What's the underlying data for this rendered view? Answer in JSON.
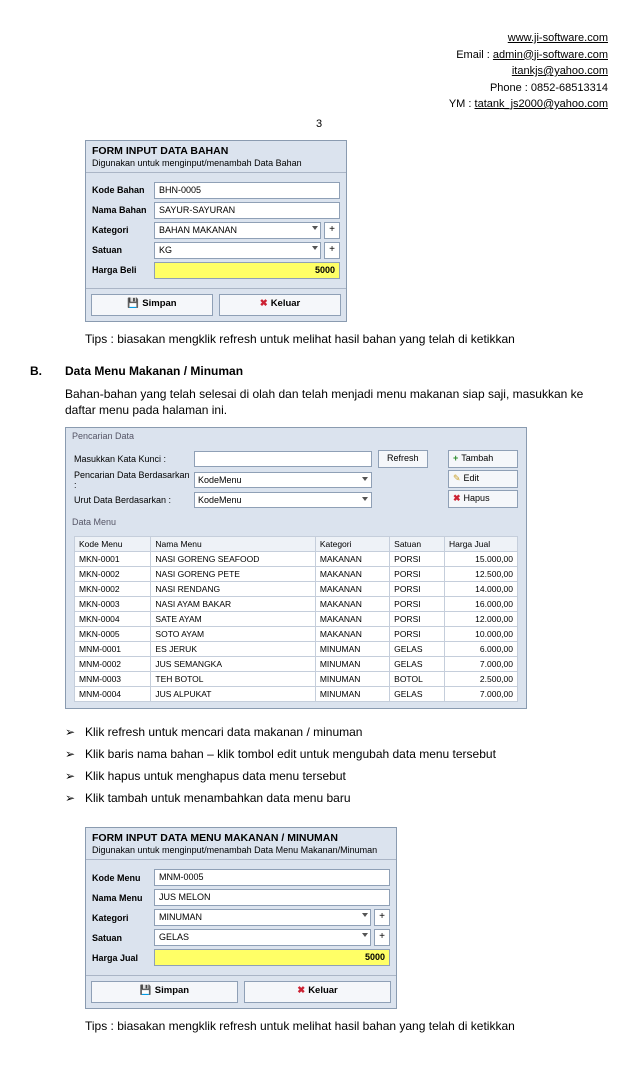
{
  "header": {
    "site": "www.ji-software.com",
    "email_label": "Email : ",
    "email": "admin@ji-software.com",
    "email2": "itankjs@yahoo.com",
    "phone": "Phone : 0852-68513314",
    "ym_label": "YM : ",
    "ym": "tatank_js2000@yahoo.com"
  },
  "page_number": "3",
  "form1": {
    "title": "FORM INPUT DATA BAHAN",
    "subtitle": "Digunakan untuk menginput/menambah Data Bahan",
    "fields": {
      "kode_label": "Kode Bahan",
      "kode_val": "BHN-0005",
      "nama_label": "Nama Bahan",
      "nama_val": "SAYUR-SAYURAN",
      "kat_label": "Kategori",
      "kat_val": "BAHAN MAKANAN",
      "sat_label": "Satuan",
      "sat_val": "KG",
      "harga_label": "Harga Beli",
      "harga_val": "5000"
    },
    "simpan": "Simpan",
    "keluar": "Keluar"
  },
  "tips1": "Tips : biasakan mengklik refresh untuk melihat hasil bahan yang telah di ketikkan",
  "sectionB": {
    "letter": "B.",
    "title": "Data Menu Makanan / Minuman",
    "intro": "Bahan-bahan yang telah selesai di olah dan telah menjadi menu makanan siap saji, masukkan ke daftar menu pada halaman ini."
  },
  "search": {
    "sec1": "Pencarian Data",
    "kata_label": "Masukkan Kata Kunci :",
    "refresh": "Refresh",
    "berdasar_label": "Pencarian Data Berdasarkan :",
    "berdasar_val": "KodeMenu",
    "urut_label": "Urut Data Berdasarkan :",
    "urut_val": "KodeMenu",
    "tambah": "Tambah",
    "edit": "Edit",
    "hapus": "Hapus",
    "sec2": "Data Menu"
  },
  "table": {
    "headers": [
      "Kode Menu",
      "Nama Menu",
      "Kategori",
      "Satuan",
      "Harga Jual"
    ],
    "rows": [
      [
        "MKN-0001",
        "NASI GORENG SEAFOOD",
        "MAKANAN",
        "PORSI",
        "15.000,00"
      ],
      [
        "MKN-0002",
        "NASI GORENG PETE",
        "MAKANAN",
        "PORSI",
        "12.500,00"
      ],
      [
        "MKN-0002",
        "NASI RENDANG",
        "MAKANAN",
        "PORSI",
        "14.000,00"
      ],
      [
        "MKN-0003",
        "NASI AYAM BAKAR",
        "MAKANAN",
        "PORSI",
        "16.000,00"
      ],
      [
        "MKN-0004",
        "SATE AYAM",
        "MAKANAN",
        "PORSI",
        "12.000,00"
      ],
      [
        "MKN-0005",
        "SOTO AYAM",
        "MAKANAN",
        "PORSI",
        "10.000,00"
      ],
      [
        "MNM-0001",
        "ES JERUK",
        "MINUMAN",
        "GELAS",
        "6.000,00"
      ],
      [
        "MNM-0002",
        "JUS SEMANGKA",
        "MINUMAN",
        "GELAS",
        "7.000,00"
      ],
      [
        "MNM-0003",
        "TEH BOTOL",
        "MINUMAN",
        "BOTOL",
        "2.500,00"
      ],
      [
        "MNM-0004",
        "JUS ALPUKAT",
        "MINUMAN",
        "GELAS",
        "7.000,00"
      ]
    ]
  },
  "bullets": [
    "Klik refresh untuk mencari data makanan / minuman",
    "Klik baris nama bahan – klik tombol edit untuk mengubah data menu tersebut",
    "Klik hapus untuk menghapus data menu tersebut",
    "Klik tambah untuk menambahkan data menu baru"
  ],
  "form2": {
    "title": "FORM INPUT DATA MENU MAKANAN / MINUMAN",
    "subtitle": "Digunakan untuk menginput/menambah Data Menu Makanan/Minuman",
    "fields": {
      "kode_label": "Kode Menu",
      "kode_val": "MNM-0005",
      "nama_label": "Nama Menu",
      "nama_val": "JUS MELON",
      "kat_label": "Kategori",
      "kat_val": "MINUMAN",
      "sat_label": "Satuan",
      "sat_val": "GELAS",
      "harga_label": "Harga Jual",
      "harga_val": "5000"
    },
    "simpan": "Simpan",
    "keluar": "Keluar"
  },
  "tips2": "Tips : biasakan mengklik refresh untuk melihat hasil bahan yang telah di ketikkan"
}
